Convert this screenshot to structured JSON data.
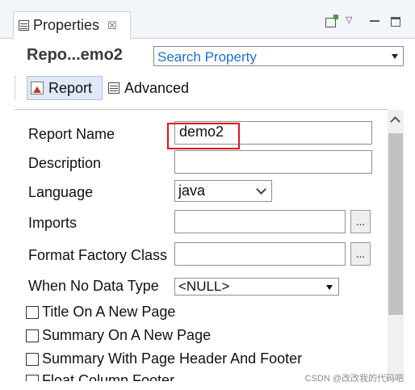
{
  "view": {
    "tab_title": "Properties",
    "tab_close": "☒",
    "menu_glyph": "▽"
  },
  "title_row": {
    "element_name": "Repo...emo2",
    "search_placeholder": "Search Property"
  },
  "categories": [
    {
      "label": "Report",
      "selected": true
    },
    {
      "label": "Advanced",
      "selected": false
    }
  ],
  "form": {
    "report_name": {
      "label": "Report Name",
      "value": "demo2"
    },
    "description": {
      "label": "Description",
      "value": ""
    },
    "language": {
      "label": "Language",
      "value": "java"
    },
    "imports": {
      "label": "Imports",
      "value": "",
      "button": "..."
    },
    "format_factory": {
      "label": "Format Factory Class",
      "value": "",
      "button": "..."
    },
    "when_no_data": {
      "label": "When No Data Type",
      "value": "<NULL>"
    },
    "checkboxes": [
      {
        "label": "Title On A New Page",
        "checked": false
      },
      {
        "label": "Summary On A New Page",
        "checked": false
      },
      {
        "label": "Summary With Page Header And Footer",
        "checked": false
      },
      {
        "label": "Float Column Footer",
        "checked": false
      }
    ]
  },
  "highlight_color": "#e01616",
  "watermark": "CSDN @改改我的代码吧"
}
